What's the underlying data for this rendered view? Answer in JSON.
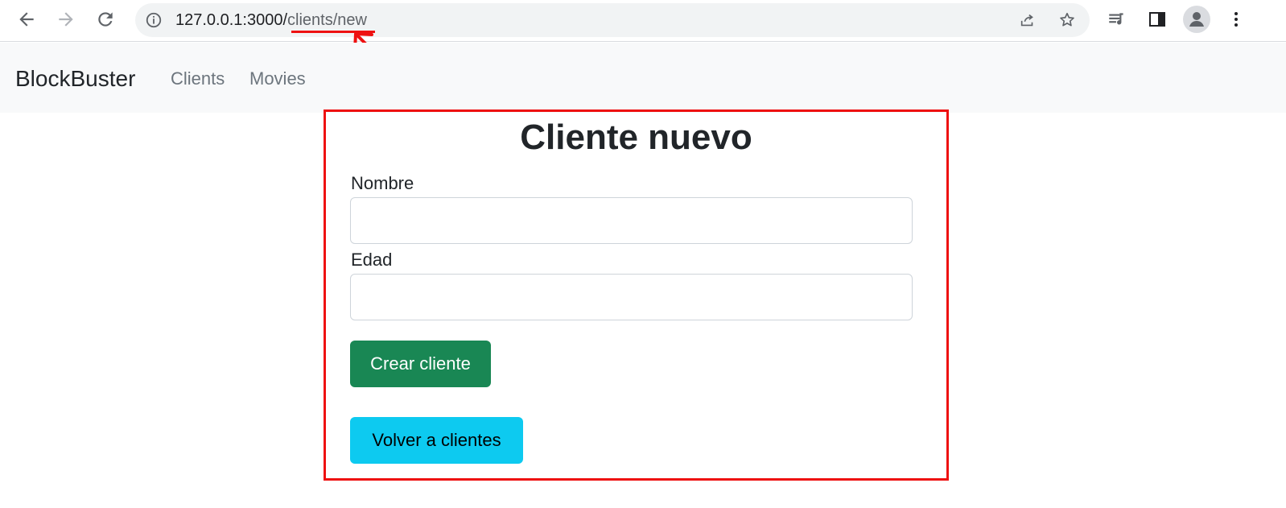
{
  "browser": {
    "url_host": "127.0.0.1:3000/",
    "url_path": "clients/new",
    "icons": [
      "back-icon",
      "forward-icon",
      "reload-icon",
      "site-info-icon",
      "share-icon",
      "star-icon",
      "reading-list-icon",
      "side-panel-icon",
      "profile-icon",
      "menu-icon"
    ]
  },
  "navbar": {
    "brand": "BlockBuster",
    "links": [
      "Clients",
      "Movies"
    ]
  },
  "form": {
    "title": "Cliente nuevo",
    "fields": [
      {
        "label": "Nombre",
        "value": ""
      },
      {
        "label": "Edad",
        "value": ""
      }
    ],
    "submit_label": "Crear cliente",
    "back_label": "Volver a clientes"
  },
  "colors": {
    "annotation": "#ee1111",
    "success": "#198754",
    "info": "#0dcaf0"
  }
}
